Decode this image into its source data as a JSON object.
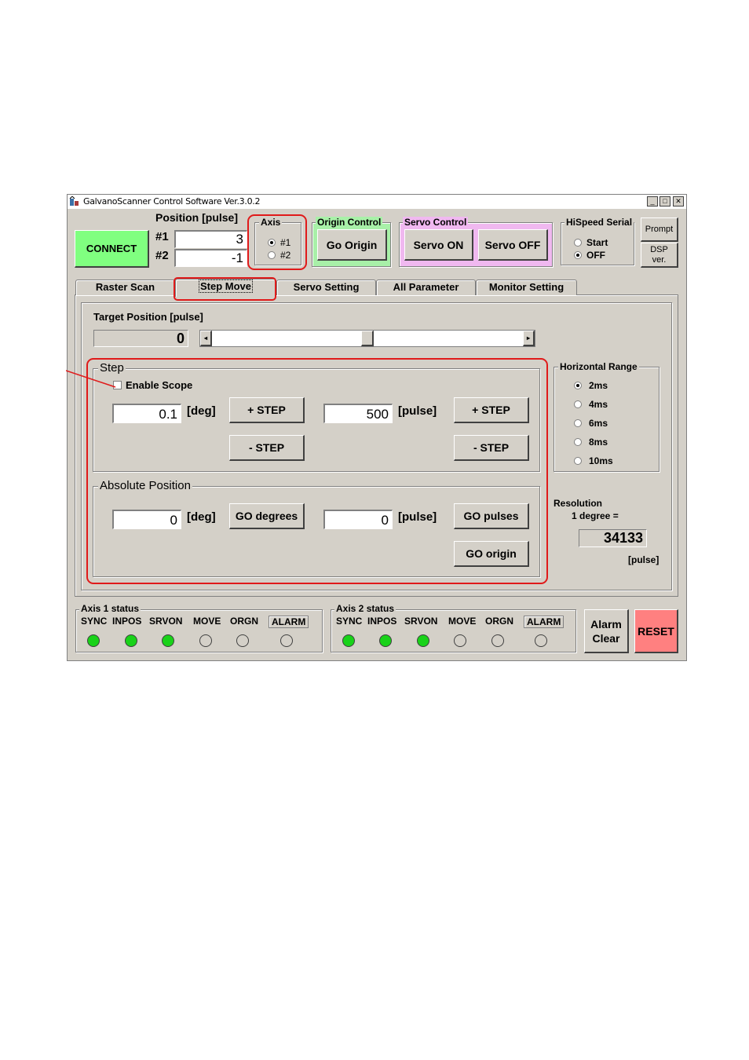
{
  "window": {
    "title": "GalvanoScanner Control Software Ver.3.0.2",
    "controls": [
      "minimize",
      "maximize",
      "close"
    ]
  },
  "connect": {
    "label": "CONNECT"
  },
  "position": {
    "title": "Position [pulse]",
    "axis1_label": "#1",
    "axis1_value": "3",
    "axis2_label": "#2",
    "axis2_value": "-1"
  },
  "axis": {
    "title": "Axis",
    "options": [
      "#1",
      "#2"
    ],
    "selected": "#1"
  },
  "origin_control": {
    "title": "Origin Control",
    "button": "Go Origin",
    "color": "#a8f0a8"
  },
  "servo_control": {
    "title": "Servo Control",
    "on": "Servo ON",
    "off": "Servo OFF",
    "color": "#f0b8f0"
  },
  "hispeed_serial": {
    "title": "HiSpeed Serial",
    "options": [
      "Start",
      "OFF"
    ],
    "selected": "OFF"
  },
  "prompt": {
    "label": "Prompt"
  },
  "dsp": {
    "line1": "DSP",
    "line2": "ver."
  },
  "tabs": [
    {
      "label": "Raster Scan"
    },
    {
      "label": "Step Move"
    },
    {
      "label": "Servo Setting"
    },
    {
      "label": "All Parameter"
    },
    {
      "label": "Monitor Setting"
    }
  ],
  "active_tab": "Step Move",
  "target": {
    "label": "Target Position [pulse]",
    "value": "0",
    "slider_level": 0.5
  },
  "step": {
    "title": "Step",
    "enable_scope": "Enable Scope",
    "enable_scope_checked": false,
    "deg_value": "0.1",
    "deg_unit": "[deg]",
    "pulse_value": "500",
    "pulse_unit": "[pulse]",
    "plus": "+ STEP",
    "minus": "- STEP"
  },
  "absolute": {
    "title": "Absolute Position",
    "deg_value": "0",
    "deg_unit": "[deg]",
    "pulse_value": "0",
    "pulse_unit": "[pulse]",
    "go_degrees": "GO degrees",
    "go_pulses": "GO pulses",
    "go_origin": "GO origin"
  },
  "horizontal_range": {
    "title": "Horizontal Range",
    "options": [
      "2ms",
      "4ms",
      "6ms",
      "8ms",
      "10ms"
    ],
    "selected": "2ms"
  },
  "resolution": {
    "label": "Resolution",
    "line2": "1 degree =",
    "value": "34133",
    "unit": "[pulse]"
  },
  "axis1_status": {
    "title": "Axis 1 status",
    "items": [
      "SYNC",
      "INPOS",
      "SRVON",
      "MOVE",
      "ORGN",
      "ALARM"
    ],
    "states": [
      true,
      true,
      true,
      false,
      false,
      false
    ]
  },
  "axis2_status": {
    "title": "Axis 2 status",
    "items": [
      "SYNC",
      "INPOS",
      "SRVON",
      "MOVE",
      "ORGN",
      "ALARM"
    ],
    "states": [
      true,
      true,
      true,
      false,
      false,
      false
    ]
  },
  "alarm_clear": {
    "line1": "Alarm",
    "line2": "Clear"
  },
  "reset": {
    "label": "RESET",
    "color": "#ff8080"
  },
  "connect_color": "#80ff80",
  "led_on_color": "#19d219",
  "highlight_color": "#e01a1a"
}
